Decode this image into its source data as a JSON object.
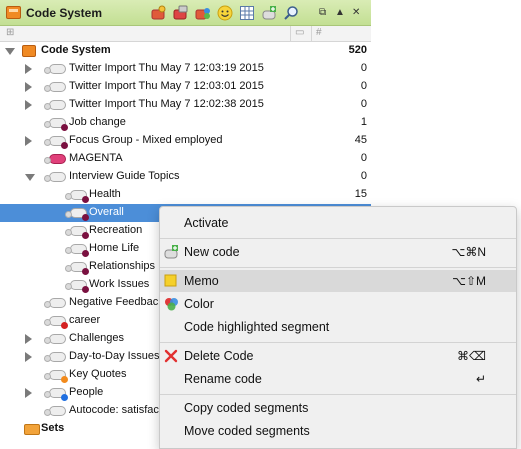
{
  "window": {
    "title": "Code System",
    "toolbar_icons": [
      "activate-codes-icon",
      "deactivate-codes-icon",
      "code-favorites-icon",
      "emoticode-icon",
      "code-matrix-icon",
      "new-code-icon",
      "search-icon"
    ],
    "window_controls": [
      "detach-window-icon",
      "collapse-icon",
      "close-icon"
    ]
  },
  "header": {
    "columns": [
      "comment-column-icon",
      "frequency-column-icon"
    ]
  },
  "tree": {
    "rows": [
      {
        "label": "Code System",
        "count": "520"
      },
      {
        "label": "Twitter Import Thu May 7 12:03:19 2015",
        "count": "0"
      },
      {
        "label": "Twitter Import Thu May 7 12:03:01 2015",
        "count": "0"
      },
      {
        "label": "Twitter Import Thu May 7 12:02:38 2015",
        "count": "0"
      },
      {
        "label": "Job change",
        "count": "1"
      },
      {
        "label": "Focus Group - Mixed employed",
        "count": "45"
      },
      {
        "label": "MAGENTA",
        "count": "0"
      },
      {
        "label": "Interview Guide Topics",
        "count": "0"
      },
      {
        "label": "Health",
        "count": "15"
      },
      {
        "label": "Overall",
        "count": ""
      },
      {
        "label": "Recreation",
        "count": ""
      },
      {
        "label": "Home Life",
        "count": ""
      },
      {
        "label": "Relationships",
        "count": ""
      },
      {
        "label": "Work Issues",
        "count": ""
      },
      {
        "label": "Negative Feedback",
        "count": ""
      },
      {
        "label": "career",
        "count": ""
      },
      {
        "label": "Challenges",
        "count": ""
      },
      {
        "label": "Day-to-Day Issues",
        "count": ""
      },
      {
        "label": "Key Quotes",
        "count": ""
      },
      {
        "label": "People",
        "count": ""
      },
      {
        "label": "Autocode: satisfac",
        "count": ""
      },
      {
        "label": "Sets",
        "count": ""
      }
    ]
  },
  "colors": {
    "titlebar": "#c3df93",
    "selection": "#4c8ed8",
    "code_dot_maroon": "#7a1040",
    "code_dot_red": "#d42020",
    "code_dot_orange": "#f28a1c",
    "code_dot_blue": "#1f6fe0",
    "magenta": "#e0407a",
    "memo_yellow": "#f5d02a"
  },
  "context_menu": {
    "items": [
      {
        "label": "Activate",
        "shortcut": ""
      },
      {
        "label": "New code",
        "shortcut": "⌥⌘N"
      },
      {
        "label": "Memo",
        "shortcut": "⌥⇧M"
      },
      {
        "label": "Color",
        "shortcut": ""
      },
      {
        "label": "Code highlighted segment",
        "shortcut": ""
      },
      {
        "label": "Delete Code",
        "shortcut": "⌘⌫"
      },
      {
        "label": "Rename code",
        "shortcut": "↵"
      },
      {
        "label": "Copy coded segments",
        "shortcut": ""
      },
      {
        "label": "Move coded segments",
        "shortcut": ""
      }
    ]
  }
}
